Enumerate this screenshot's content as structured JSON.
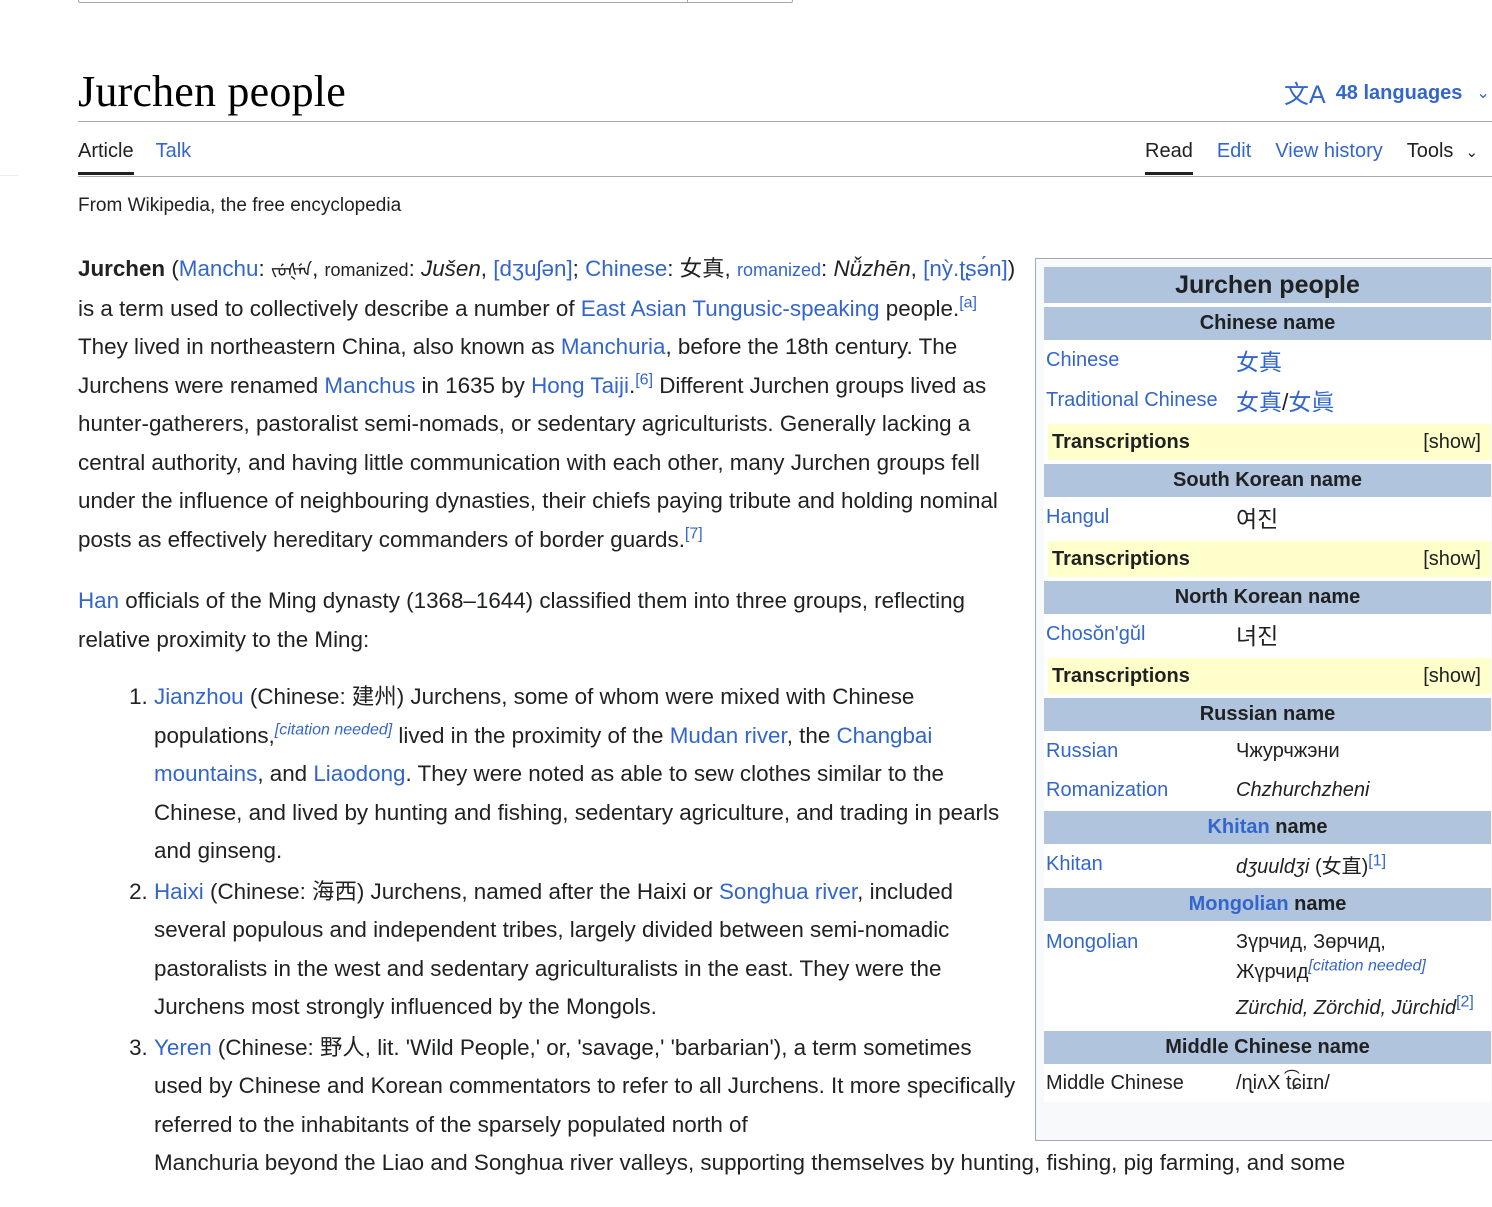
{
  "page": {
    "title": "Jurchen people",
    "languages": "48 languages",
    "tagline": "From Wikipedia, the free encyclopedia"
  },
  "tabs": {
    "article": "Article",
    "talk": "Talk",
    "read": "Read",
    "edit": "Edit",
    "history": "View history",
    "tools": "Tools"
  },
  "intro": {
    "bold": "Jurchen",
    "manchu_link": "Manchu",
    "manchu_script": "ᠵᡠᡧᡝᠨ",
    "romanized_label": "romanized",
    "romanized_value": "Jušen",
    "ipa1": "[dʒuʃən]",
    "chinese_link": "Chinese",
    "chinese_value": "女真",
    "romanized_link": "romanized",
    "pinyin": "Nǚzhēn",
    "ipa2": "[nỳ.ʈʂə́n]",
    "t1": ") is a term used to collectively describe a number of ",
    "tungusic_link": "East Asian Tungusic-speaking",
    "t2": " people.",
    "ref_a": "[a]",
    "t3": " They lived in northeastern China, also known as ",
    "manchuria_link": "Manchuria",
    "t4": ", before the 18th century. The Jurchens were renamed ",
    "manchus_link": "Manchus",
    "t5": " in 1635 by ",
    "hong_link": "Hong Taiji",
    "ref_6": "[6]",
    "t6": " Different Jurchen groups lived as hunter-gatherers, pastoralist semi-nomads, or sedentary agriculturists. Generally lacking a central authority, and having little communication with each other, many Jurchen groups fell under the influence of neighbouring dynasties, their chiefs paying tribute and holding nominal posts as effectively hereditary commanders of border guards.",
    "ref_7": "[7]"
  },
  "para2": {
    "han_link": "Han",
    "text": " officials of the Ming dynasty (1368–1644) classified them into three groups, reflecting relative proximity to the Ming:"
  },
  "groups": [
    {
      "link": "Jianzhou",
      "t1": " (Chinese: 建州) Jurchens, some of whom were mixed with Chinese populations,",
      "cn": "[citation needed]",
      "t2": " lived in the proximity of the ",
      "mudan": "Mudan river",
      "t3": ", the ",
      "changbai": "Changbai mountains",
      "t4": ", and ",
      "liaodong": "Liaodong",
      "t5": ". They were noted as able to sew clothes similar to the Chinese, and lived by hunting and fishing, sedentary agriculture, and trading in pearls and ginseng."
    },
    {
      "link": "Haixi",
      "t1": " (Chinese: 海西) Jurchens, named after the Haixi or ",
      "songhua": "Songhua river",
      "t2": ", included several populous and independent tribes, largely divided between semi-nomadic pastoralists in the west and sedentary agriculturalists in the east. They were the Jurchens most strongly influenced by the Mongols."
    },
    {
      "link": "Yeren",
      "t1": " (Chinese: 野人, lit. 'Wild People,' or, 'savage,' 'barbarian'), a term sometimes used by Chinese and Korean commentators to refer to all Jurchens. It more specifically referred to the inhabitants of the sparsely populated north of",
      "t2": "Manchuria beyond the Liao and Songhua river valleys, supporting themselves by hunting, fishing, pig farming, and some"
    }
  ],
  "infobox": {
    "title": "Jurchen people",
    "chinese_head": "Chinese name",
    "chinese_lbl": "Chinese",
    "chinese_val": "女真",
    "trad_lbl": "Traditional Chinese",
    "trad_val1": "女真",
    "trad_sep": "/",
    "trad_val2": "女眞",
    "transcriptions": "Transcriptions",
    "show": "[show]",
    "sk_head": "South Korean name",
    "hangul_lbl": "Hangul",
    "hangul_val": "여진",
    "nk_head": "North Korean name",
    "choson_lbl": "Chosŏn'gŭl",
    "choson_val": "녀진",
    "ru_head": "Russian name",
    "ru_lbl": "Russian",
    "ru_val": "Чжурчжэни",
    "rom_lbl": "Romanization",
    "rom_val": "Chzhurchzheni",
    "khitan_link": "Khitan",
    "khitan_head_rest": " name",
    "khitan_lbl": "Khitan",
    "khitan_val": "dʒuuldʒi",
    "khitan_zh": " (女直)",
    "ref_1": "[1]",
    "mong_link": "Mongolian",
    "mong_head_rest": " name",
    "mong_lbl": "Mongolian",
    "mong_val1": "Зүрчид, Зөрчид,",
    "mong_val2": "Жүрчид",
    "mong_cn": "[citation needed]",
    "mong_latin": "Zürchid, Zörchid, Jürchid",
    "ref_2": "[2]",
    "mc_head": "Middle Chinese name",
    "mc_lbl": "Middle Chinese",
    "mc_val": "/ɳiʌX t͡ɕiɪn/"
  },
  "colors": {
    "link": "#3366cc",
    "infobox_header": "#b0c4de",
    "transcription_bg": "#ffffcc"
  }
}
